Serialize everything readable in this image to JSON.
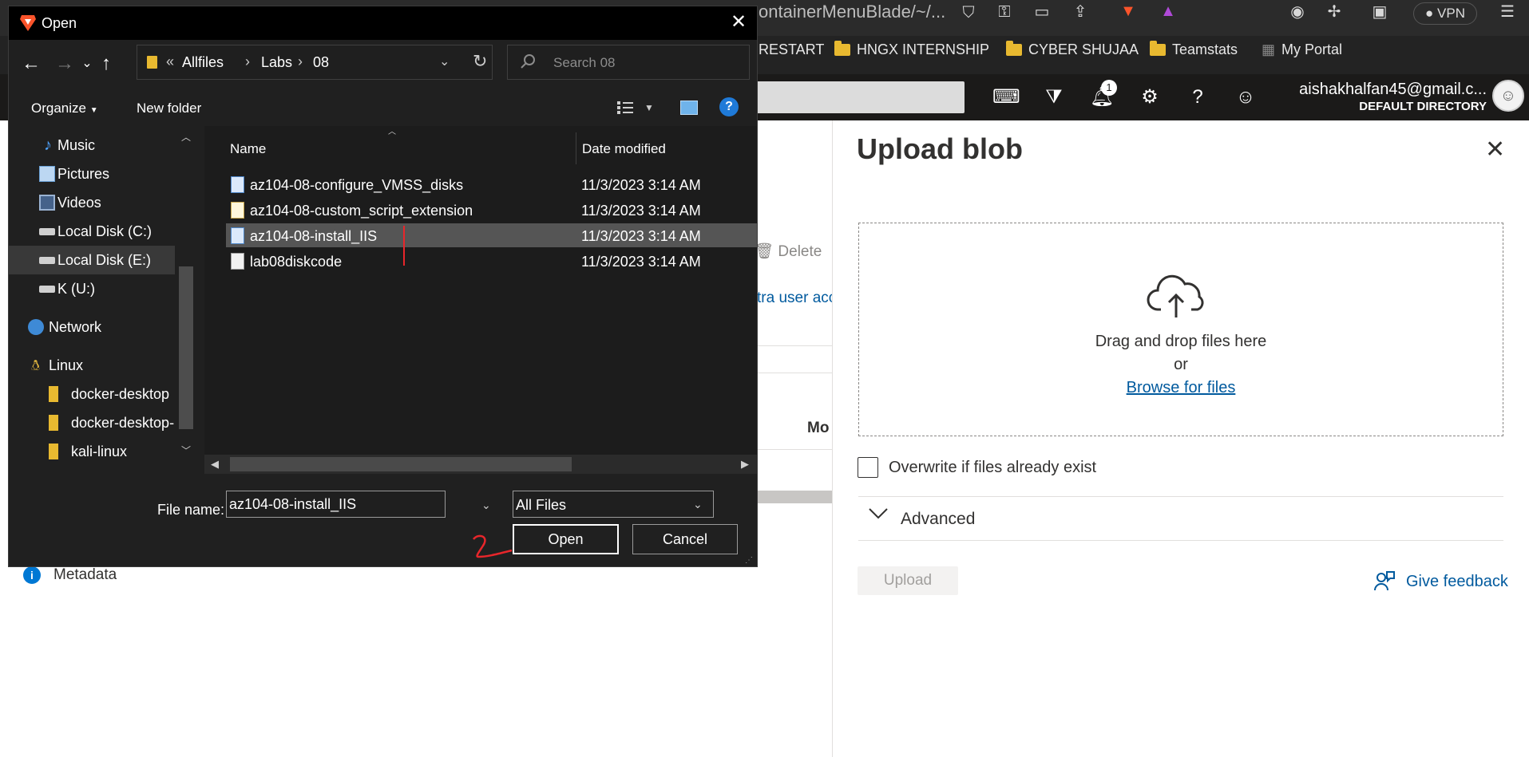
{
  "browser": {
    "url_fragment": "ontainerMenuBlade/~/...",
    "vpn_label": "VPN",
    "bookmarks": [
      "RESTART",
      "HNGX INTERNSHIP",
      "CYBER SHUJAA",
      "Teamstats",
      "My Portal"
    ]
  },
  "portal": {
    "notification_count": "1",
    "account_name": "aishakhalfan45@gmail.c...",
    "account_directory": "DEFAULT DIRECTORY"
  },
  "background_page": {
    "delete_label": "Delete",
    "link_fragment": "tra user acc",
    "column_fragment": "Mo",
    "metadata_label": "Metadata"
  },
  "upload_panel": {
    "title": "Upload blob",
    "drop_text": "Drag and drop files here",
    "or_text": "or",
    "browse_link": "Browse for files",
    "overwrite_label": "Overwrite if files already exist",
    "advanced_label": "Advanced",
    "upload_button": "Upload",
    "feedback_link": "Give feedback"
  },
  "dialog": {
    "title": "Open",
    "breadcrumb": [
      "Allfiles",
      "Labs",
      "08"
    ],
    "search_placeholder": "Search 08",
    "organize_label": "Organize",
    "new_folder_label": "New folder",
    "nav_items": [
      {
        "label": "Music",
        "icon": "music-icon"
      },
      {
        "label": "Pictures",
        "icon": "pictures-icon"
      },
      {
        "label": "Videos",
        "icon": "videos-icon"
      },
      {
        "label": "Local Disk (C:)",
        "icon": "drive-icon"
      },
      {
        "label": "Local Disk (E:)",
        "icon": "drive-icon",
        "selected": true
      },
      {
        "label": "K (U:)",
        "icon": "drive-icon"
      },
      {
        "label": "Network",
        "icon": "network-icon"
      },
      {
        "label": "Linux",
        "icon": "linux-icon"
      },
      {
        "label": "docker-desktop",
        "icon": "folder-icon"
      },
      {
        "label": "docker-desktop-",
        "icon": "folder-icon"
      },
      {
        "label": "kali-linux",
        "icon": "folder-icon"
      }
    ],
    "columns": {
      "name": "Name",
      "date": "Date modified"
    },
    "files": [
      {
        "name": "az104-08-configure_VMSS_disks",
        "date": "11/3/2023 3:14 AM",
        "icon": "script-file-icon"
      },
      {
        "name": "az104-08-custom_script_extension",
        "date": "11/3/2023 3:14 AM",
        "icon": "code-file-icon"
      },
      {
        "name": "az104-08-install_IIS",
        "date": "11/3/2023 3:14 AM",
        "icon": "script-file-icon",
        "selected": true
      },
      {
        "name": "lab08diskcode",
        "date": "11/3/2023 3:14 AM",
        "icon": "text-file-icon"
      }
    ],
    "file_name_label": "File name:",
    "file_name_value": "az104-08-install_IIS",
    "file_type": "All Files",
    "open_button": "Open",
    "cancel_button": "Cancel"
  },
  "colors": {
    "azure_blue": "#0078d4",
    "link_blue": "#005a9e",
    "dialog_bg": "#202020",
    "annotation_red": "#e8262b"
  }
}
